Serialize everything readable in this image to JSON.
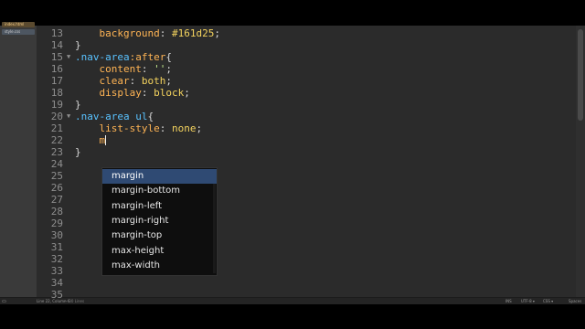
{
  "sidebar": {
    "files": [
      {
        "label": "index.html"
      },
      {
        "label": "style.css"
      }
    ]
  },
  "editor": {
    "line_numbers": [
      "13",
      "14",
      "15",
      "16",
      "17",
      "18",
      "19",
      "20",
      "21",
      "22",
      "23",
      "24",
      "25",
      "26",
      "27",
      "28",
      "29",
      "30",
      "31",
      "32",
      "33",
      "34",
      "35"
    ],
    "fold_markers": [
      {
        "line_index": 2,
        "icon": "▼"
      },
      {
        "line_index": 7,
        "icon": "▼"
      }
    ],
    "lines": [
      {
        "indent": "    ",
        "prop": "background",
        "colon": ": ",
        "value": "#161d25",
        "end": ";"
      },
      {
        "text": "}"
      },
      {
        "selector": ".nav-area",
        "pseudo": ":after",
        "brace": "{"
      },
      {
        "indent": "    ",
        "prop": "content",
        "colon": ": ",
        "value": "''",
        "end": ";"
      },
      {
        "indent": "    ",
        "prop": "clear",
        "colon": ": ",
        "value": "both",
        "end": ";"
      },
      {
        "indent": "    ",
        "prop": "display",
        "colon": ": ",
        "value": "block",
        "end": ";"
      },
      {
        "text": "}"
      },
      {
        "selector": ".nav-area ul",
        "brace": "{"
      },
      {
        "indent": "    ",
        "prop": "list-style",
        "colon": ": ",
        "value": "none",
        "end": ";"
      },
      {
        "indent": "    ",
        "typed": "m"
      },
      {
        "text": "}"
      }
    ]
  },
  "autocomplete": {
    "selected_index": 0,
    "items": [
      "margin",
      "margin-bottom",
      "margin-left",
      "margin-right",
      "margin-top",
      "max-height",
      "max-width"
    ]
  },
  "status_bar": {
    "icon": "monitor-icon",
    "position": "Line 22, Column 6",
    "extra": "— 30 Lines",
    "tab_size": "INS",
    "encoding": "UTF-8 ▾",
    "language": "CSS ▾",
    "right": "Spaces"
  },
  "colors": {
    "selector": "#59c2ff",
    "property": "#ffb454",
    "value": "#f4d35e",
    "string": "#c3e88d",
    "popup_selected": "#2f4a73",
    "editor_bg": "#2b2b2b"
  }
}
